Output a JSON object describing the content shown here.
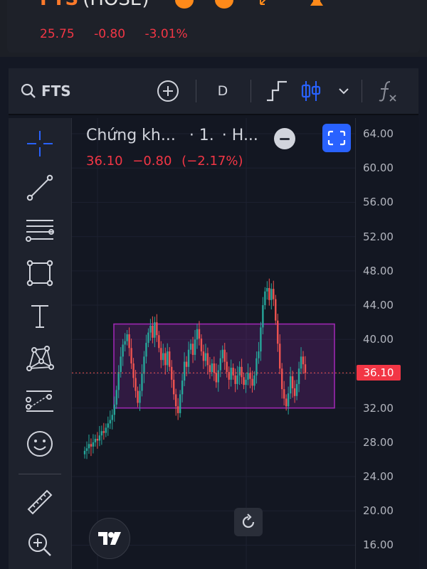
{
  "header": {
    "ticker": "FTS",
    "exchange": "(HOSE)",
    "price": "25.75",
    "change": "-0.80",
    "change_pct": "-3.01%"
  },
  "toolbar": {
    "symbol": "FTS",
    "interval": "D"
  },
  "legend": {
    "title": "Chứng kh...",
    "interval": "· 1.",
    "exchange": "· H...",
    "close": "36.10",
    "change": "−0.80",
    "change_pct": "(−2.17%)"
  },
  "price_axis": {
    "ticks": [
      "64.00",
      "60.00",
      "56.00",
      "52.00",
      "48.00",
      "44.00",
      "40.00",
      "36.10",
      "32.00",
      "28.00",
      "24.00",
      "20.00",
      "16.00"
    ],
    "current_price": "36.10"
  },
  "colors": {
    "up": "#26a69a",
    "down": "#ef5350",
    "accent": "#2962ff",
    "range_box": "#9c27b0"
  },
  "chart_data": {
    "type": "candlestick",
    "ylim": [
      14,
      65
    ],
    "last_price": 36.1,
    "range_box": {
      "low": 32.0,
      "high": 41.8
    },
    "closes": [
      27.0,
      27.3,
      27.8,
      27.5,
      28.0,
      28.4,
      28.2,
      28.8,
      29.3,
      29.1,
      29.7,
      30.2,
      30.6,
      31.2,
      32.4,
      34.1,
      36.2,
      38.0,
      39.4,
      39.8,
      40.6,
      39.0,
      37.2,
      35.5,
      34.0,
      32.6,
      34.0,
      36.0,
      38.0,
      39.6,
      40.8,
      41.6,
      40.2,
      42.0,
      40.5,
      39.0,
      37.6,
      38.4,
      37.0,
      38.6,
      36.8,
      35.3,
      33.6,
      32.2,
      31.4,
      33.6,
      35.2,
      37.4,
      36.8,
      38.8,
      39.5,
      38.2,
      40.0,
      41.2,
      40.1,
      38.6,
      37.5,
      38.4,
      37.0,
      36.2,
      37.2,
      36.1,
      35.0,
      36.4,
      37.8,
      38.8,
      37.4,
      36.2,
      35.3,
      36.7,
      35.8,
      34.8,
      35.8,
      36.8,
      35.6,
      34.7,
      35.3,
      36.1,
      35.4,
      34.6,
      35.8,
      37.8,
      38.6,
      41.4,
      44.0,
      45.6,
      46.0,
      44.6,
      45.9,
      44.7,
      42.2,
      39.5,
      36.6,
      34.2,
      33.1,
      32.2,
      33.7,
      35.7,
      34.3,
      33.4,
      34.8,
      36.6,
      38.0,
      37.1,
      36.1
    ]
  }
}
